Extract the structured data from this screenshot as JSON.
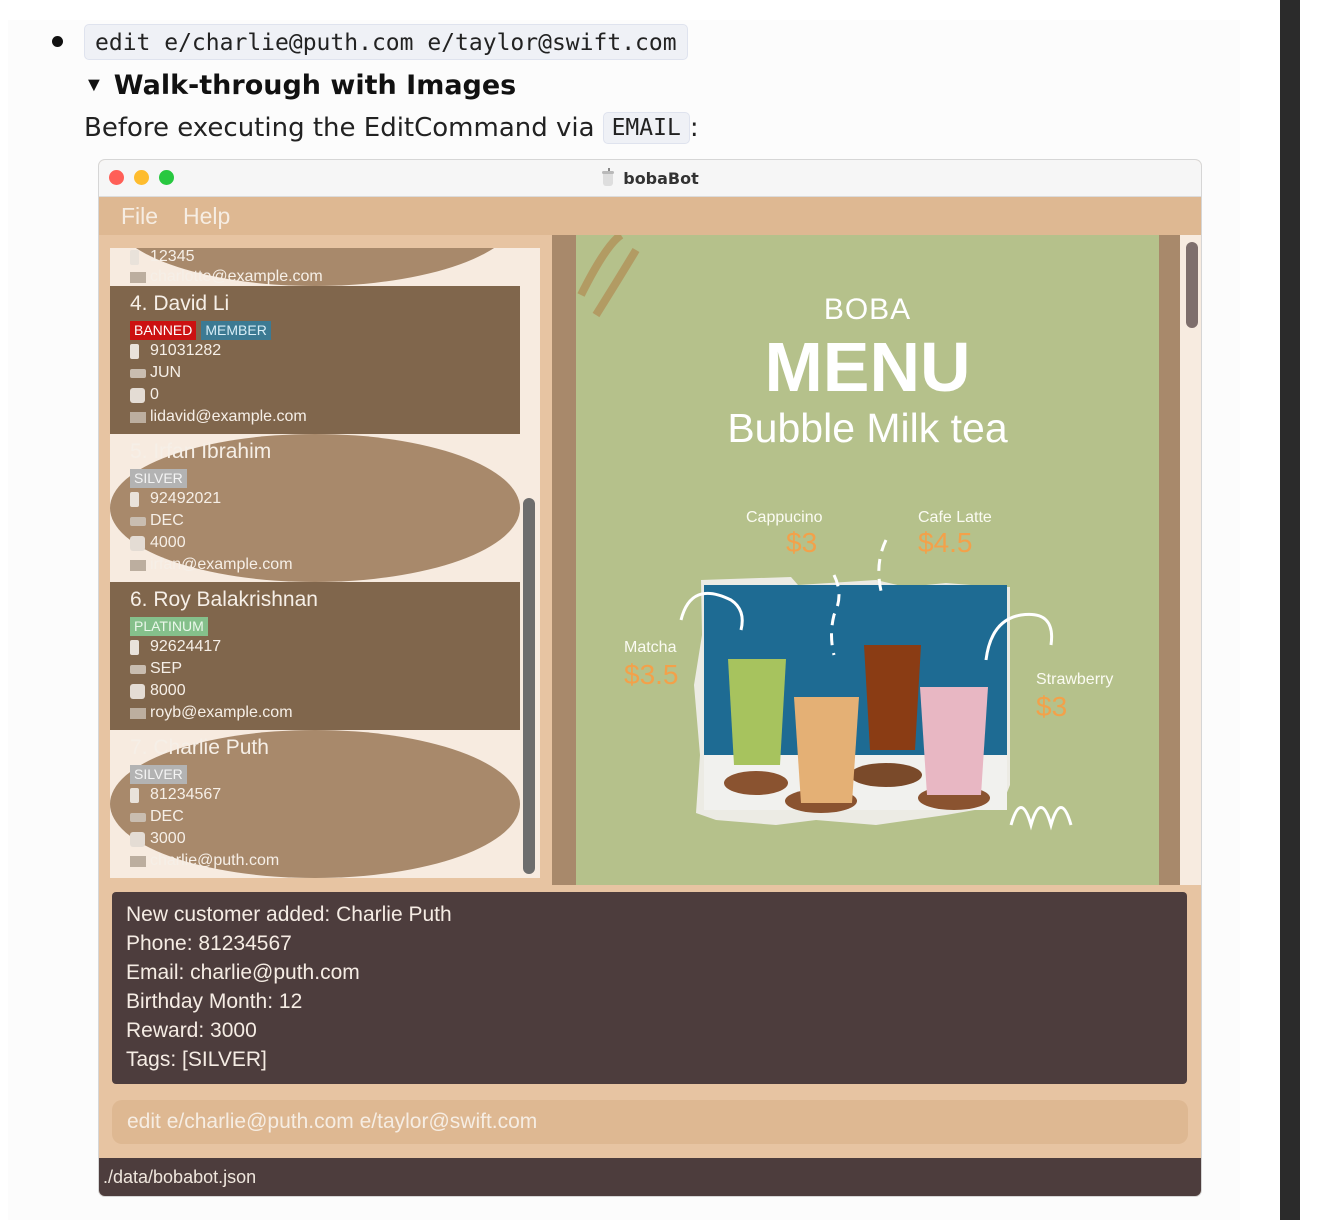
{
  "doc": {
    "bullet_code": "edit e/charlie@puth.com e/taylor@swift.com",
    "summary": "Walk-through with Images",
    "para_text": "Before executing the EditCommand via",
    "para_code": "EMAIL",
    "para_suffix": ":"
  },
  "window": {
    "title": "bobaBot",
    "menu": {
      "file": "File",
      "help": "Help"
    }
  },
  "list": {
    "partial": {
      "phone_fragment": "12345",
      "email": "charlotte@example.com"
    },
    "cards": [
      {
        "name": "4.  David Li",
        "tags": [
          "BANNED",
          "MEMBER"
        ],
        "phone": "91031282",
        "month": "JUN",
        "reward": "0",
        "email": "lidavid@example.com"
      },
      {
        "name": "5.  Irfan Ibrahim",
        "tags": [
          "SILVER"
        ],
        "phone": "92492021",
        "month": "DEC",
        "reward": "4000",
        "email": "irfan@example.com"
      },
      {
        "name": "6.  Roy Balakrishnan",
        "tags": [
          "PLATINUM"
        ],
        "phone": "92624417",
        "month": "SEP",
        "reward": "8000",
        "email": "royb@example.com"
      },
      {
        "name": "7.  Charlie Puth",
        "tags": [
          "SILVER"
        ],
        "phone": "81234567",
        "month": "DEC",
        "reward": "3000",
        "email": "charlie@puth.com"
      }
    ]
  },
  "menu_image": {
    "boba": "BOBA",
    "menu": "MENU",
    "subtitle": "Bubble Milk tea",
    "drinks": [
      {
        "name": "Cappucino",
        "price": "$3"
      },
      {
        "name": "Cafe Latte",
        "price": "$4.5"
      },
      {
        "name": "Matcha",
        "price": "$3.5"
      },
      {
        "name": "Strawberry",
        "price": "$3"
      }
    ]
  },
  "result": {
    "lines": [
      "New customer added: Charlie Puth",
      "Phone: 81234567",
      "Email: charlie@puth.com",
      "Birthday Month: 12",
      "Reward: 3000",
      "Tags: [SILVER]"
    ]
  },
  "command_input": "edit e/charlie@puth.com e/taylor@swift.com",
  "status_bar": "./data/bobabot.json",
  "colors": {
    "menu_bar": "#deb892",
    "card_dark": "#80664c",
    "card_light": "#a8896b",
    "result_bg": "#4d3d3d",
    "menu_image_bg": "#b5c18b",
    "price_orange": "#f3a14a",
    "banned_red": "#cc1111",
    "member_blue": "#3c7a93",
    "silver_gray": "#b3b3b3",
    "platinum_green": "#85c08b"
  }
}
